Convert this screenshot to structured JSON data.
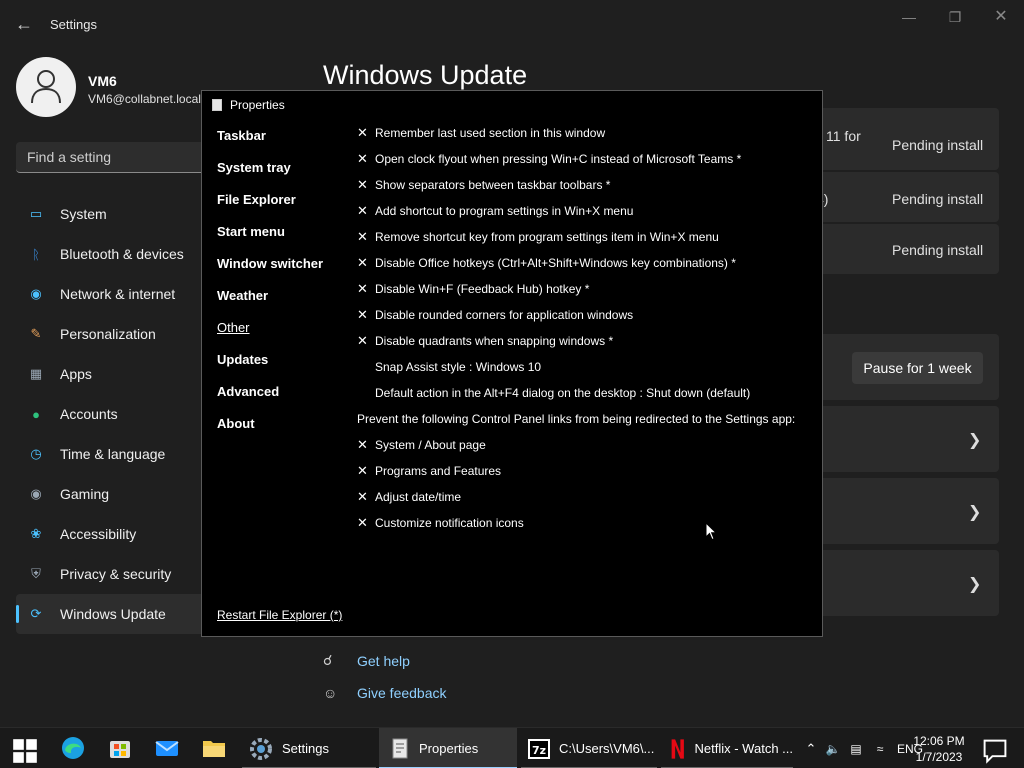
{
  "settings": {
    "app_title": "Settings",
    "profile": {
      "name": "VM6",
      "email": "VM6@collabnet.local"
    },
    "search_placeholder": "Find a setting",
    "nav": [
      {
        "label": "System",
        "icon": "monitor-icon",
        "color": "#4cc2ff"
      },
      {
        "label": "Bluetooth & devices",
        "icon": "bluetooth-icon",
        "color": "#3a8dde"
      },
      {
        "label": "Network & internet",
        "icon": "wifi-icon",
        "color": "#4cc2ff"
      },
      {
        "label": "Personalization",
        "icon": "brush-icon",
        "color": "#e8a25c"
      },
      {
        "label": "Apps",
        "icon": "apps-icon",
        "color": "#9aa7b5"
      },
      {
        "label": "Accounts",
        "icon": "person-icon",
        "color": "#2ec27e"
      },
      {
        "label": "Time & language",
        "icon": "globe-clock-icon",
        "color": "#4cc2ff"
      },
      {
        "label": "Gaming",
        "icon": "gamepad-icon",
        "color": "#9aa7b5"
      },
      {
        "label": "Accessibility",
        "icon": "accessibility-icon",
        "color": "#4cc2ff"
      },
      {
        "label": "Privacy & security",
        "icon": "shield-icon",
        "color": "#9aa7b5"
      },
      {
        "label": "Windows Update",
        "icon": "update-icon",
        "color": "#4cc2ff"
      }
    ],
    "active_nav": "Windows Update",
    "main_title": "Windows Update",
    "updates": [
      {
        "fragment": "11 for",
        "status": "Pending install"
      },
      {
        "fragment": "4)",
        "status": "Pending install"
      },
      {
        "fragment": "",
        "status": "Pending install"
      }
    ],
    "pause_button": "Pause for 1 week",
    "help": {
      "get_help": "Get help",
      "give_feedback": "Give feedback"
    }
  },
  "properties": {
    "title": "Properties",
    "sections": [
      "Taskbar",
      "System tray",
      "File Explorer",
      "Start menu",
      "Window switcher",
      "Weather",
      "Other",
      "Updates",
      "Advanced",
      "About"
    ],
    "current_section": "Other",
    "options": [
      {
        "checked": true,
        "text": "Remember last used section in this window"
      },
      {
        "checked": true,
        "text": "Open clock flyout when pressing Win+C instead of Microsoft Teams *"
      },
      {
        "checked": true,
        "text": "Show separators between taskbar toolbars *"
      },
      {
        "checked": true,
        "text": "Add shortcut to program settings in Win+X menu"
      },
      {
        "checked": true,
        "text": "Remove shortcut key from program settings item in Win+X menu"
      },
      {
        "checked": true,
        "text": "Disable Office hotkeys (Ctrl+Alt+Shift+Windows key combinations) *"
      },
      {
        "checked": true,
        "text": "Disable Win+F (Feedback Hub) hotkey *"
      },
      {
        "checked": true,
        "text": "Disable rounded corners for application windows"
      },
      {
        "checked": true,
        "text": "Disable quadrants when snapping windows *"
      },
      {
        "checked": false,
        "text": "Snap Assist style : Windows 10"
      },
      {
        "checked": false,
        "text": "Default action in the Alt+F4 dialog on the desktop : Shut down (default)"
      },
      {
        "heading": true,
        "text": "Prevent the following Control Panel links from being redirected to the Settings app:"
      },
      {
        "checked": true,
        "text": "System / About page"
      },
      {
        "checked": true,
        "text": "Programs and Features"
      },
      {
        "checked": true,
        "text": "Adjust date/time"
      },
      {
        "checked": true,
        "text": "Customize notification icons"
      }
    ],
    "check_glyph": "✕",
    "restart_link": "Restart File Explorer (*)"
  },
  "taskbar": {
    "apps": [
      {
        "label": "Settings",
        "icon": "settings-gear-icon"
      },
      {
        "label": "Properties",
        "icon": "properties-doc-icon",
        "active": true
      },
      {
        "label": "C:\\Users\\VM6\\...",
        "icon": "sevenzip-icon"
      },
      {
        "label": "Netflix - Watch ...",
        "icon": "netflix-icon"
      }
    ],
    "language": "ENG",
    "time": "12:06 PM",
    "date": "1/7/2023"
  }
}
